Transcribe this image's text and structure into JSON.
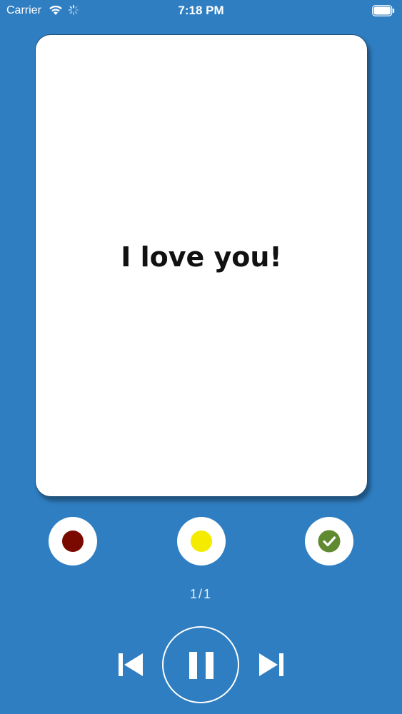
{
  "status_bar": {
    "carrier": "Carrier",
    "time": "7:18 PM"
  },
  "card": {
    "text": "I love you!"
  },
  "rating": {
    "again_color": "#7A0A00",
    "hard_color": "#F5EB00",
    "good_color": "#5F8A30"
  },
  "progress": {
    "text": "1/1"
  },
  "icons": {
    "prev": "skip-previous-icon",
    "pause": "pause-icon",
    "next": "skip-next-icon"
  },
  "colors": {
    "background": "#2F7EC1",
    "card": "#FFFFFF"
  }
}
